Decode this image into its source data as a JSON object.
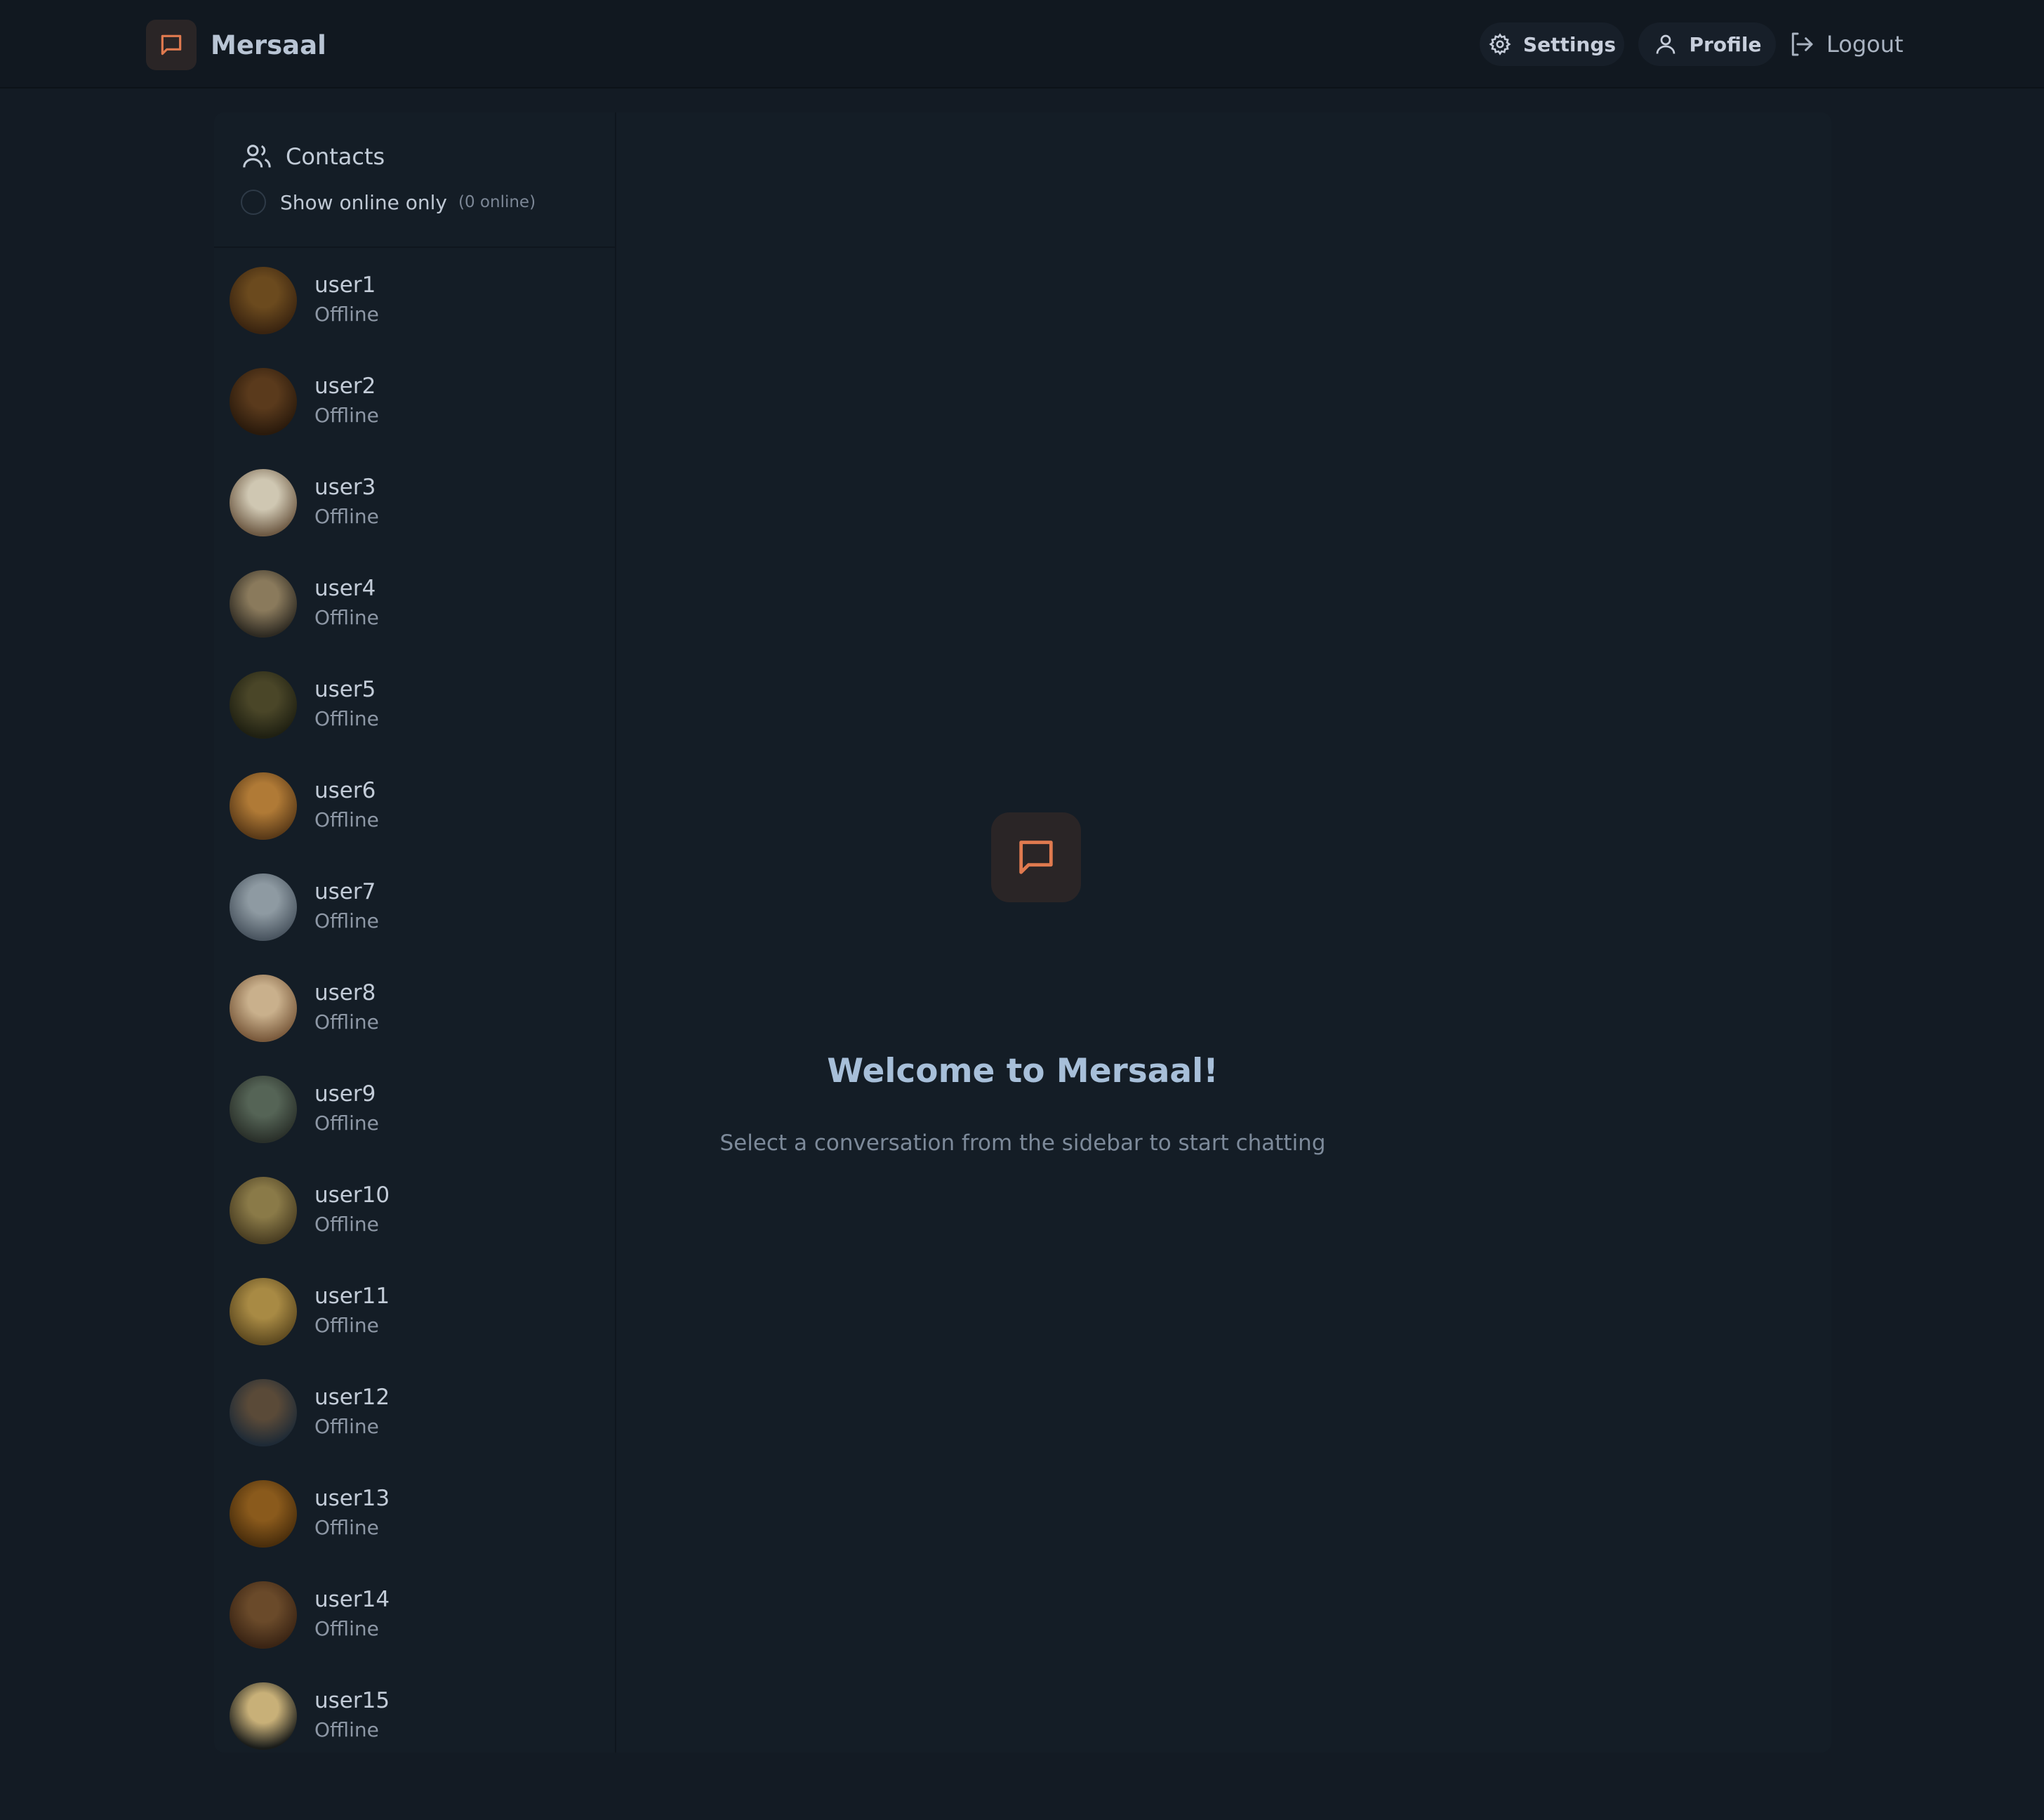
{
  "brand": {
    "name": "Mersaal",
    "icon": "chat-bubble-icon",
    "accent": "#e07a4f"
  },
  "nav": {
    "settings_label": "Settings",
    "profile_label": "Profile",
    "logout_label": "Logout"
  },
  "sidebar": {
    "title": "Contacts",
    "online_toggle_label": "Show online only",
    "online_count": "(0 online)",
    "contacts": [
      {
        "name": "user1",
        "status": "Offline"
      },
      {
        "name": "user2",
        "status": "Offline"
      },
      {
        "name": "user3",
        "status": "Offline"
      },
      {
        "name": "user4",
        "status": "Offline"
      },
      {
        "name": "user5",
        "status": "Offline"
      },
      {
        "name": "user6",
        "status": "Offline"
      },
      {
        "name": "user7",
        "status": "Offline"
      },
      {
        "name": "user8",
        "status": "Offline"
      },
      {
        "name": "user9",
        "status": "Offline"
      },
      {
        "name": "user10",
        "status": "Offline"
      },
      {
        "name": "user11",
        "status": "Offline"
      },
      {
        "name": "user12",
        "status": "Offline"
      },
      {
        "name": "user13",
        "status": "Offline"
      },
      {
        "name": "user14",
        "status": "Offline"
      },
      {
        "name": "user15",
        "status": "Offline"
      }
    ]
  },
  "welcome": {
    "title": "Welcome to Mersaal!",
    "subtitle": "Select a conversation from the sidebar to start chatting"
  }
}
